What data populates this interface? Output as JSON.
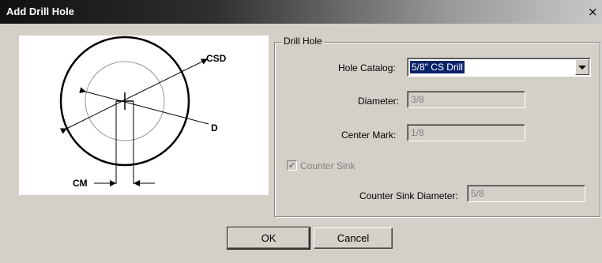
{
  "dialog": {
    "title": "Add Drill Hole",
    "close_glyph": "×"
  },
  "diagram": {
    "label_csd": "CSD",
    "label_d": "D",
    "label_cm": "CM"
  },
  "group": {
    "legend": "Drill Hole",
    "hole_catalog_label": "Hole Catalog:",
    "hole_catalog_value": "5/8\" CS Drill",
    "diameter_label": "Diameter:",
    "diameter_value": "3/8",
    "center_mark_label": "Center Mark:",
    "center_mark_value": "1/8",
    "counter_sink_label": "Counter Sink",
    "counter_sink_checked": true,
    "counter_sink_check_glyph": "✔",
    "counter_sink_diameter_label": "Counter Sink Diameter:",
    "counter_sink_diameter_value": "5/8"
  },
  "buttons": {
    "ok": "OK",
    "cancel": "Cancel"
  }
}
